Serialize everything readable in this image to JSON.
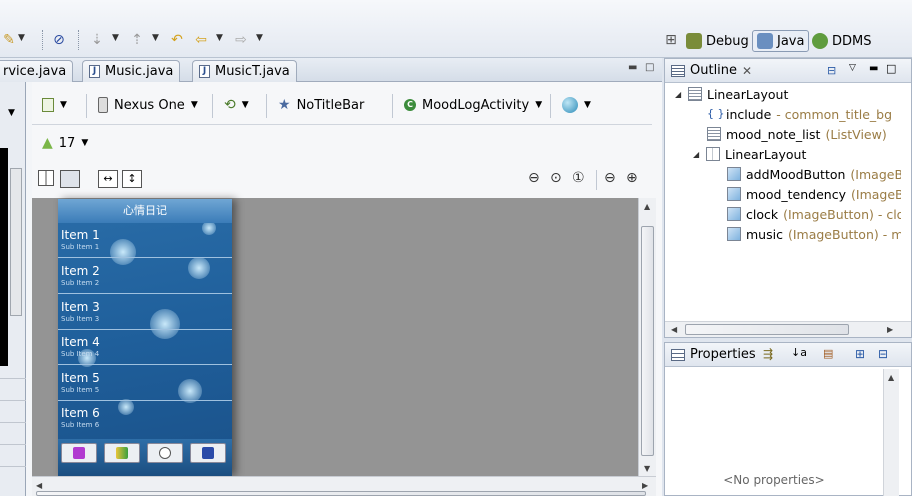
{
  "toolbar": {
    "perspectives": [
      {
        "label": "Debug"
      },
      {
        "label": "Java"
      },
      {
        "label": "DDMS"
      }
    ]
  },
  "editor": {
    "tabs": [
      {
        "label": "rvice.java"
      },
      {
        "label": "Music.java"
      },
      {
        "label": "MusicT.java"
      }
    ]
  },
  "layout_toolbar": {
    "device": "Nexus One",
    "theme": "NoTitleBar",
    "activity": "MoodLogActivity",
    "api_level": "17"
  },
  "phone": {
    "title": "心情日记",
    "items": [
      {
        "title": "Item 1",
        "sub": "Sub Item 1"
      },
      {
        "title": "Item 2",
        "sub": "Sub Item 2"
      },
      {
        "title": "Item 3",
        "sub": "Sub Item 3"
      },
      {
        "title": "Item 4",
        "sub": "Sub Item 4"
      },
      {
        "title": "Item 5",
        "sub": "Sub Item 5"
      },
      {
        "title": "Item 6",
        "sub": "Sub Item 6"
      }
    ]
  },
  "outline": {
    "title": "Outline",
    "rows": [
      {
        "name": "LinearLayout",
        "type": ""
      },
      {
        "name": "include",
        "type": " - common_title_bg"
      },
      {
        "name": "mood_note_list",
        "type": " (ListView)"
      },
      {
        "name": "LinearLayout",
        "type": ""
      },
      {
        "name": "addMoodButton",
        "type": " (ImageB"
      },
      {
        "name": "mood_tendency",
        "type": " (ImageBu"
      },
      {
        "name": "clock",
        "type": " (ImageButton) - cloc"
      },
      {
        "name": "music",
        "type": " (ImageButton) - mu"
      }
    ]
  },
  "properties": {
    "title": "Properties",
    "empty_text": "<No properties>"
  }
}
